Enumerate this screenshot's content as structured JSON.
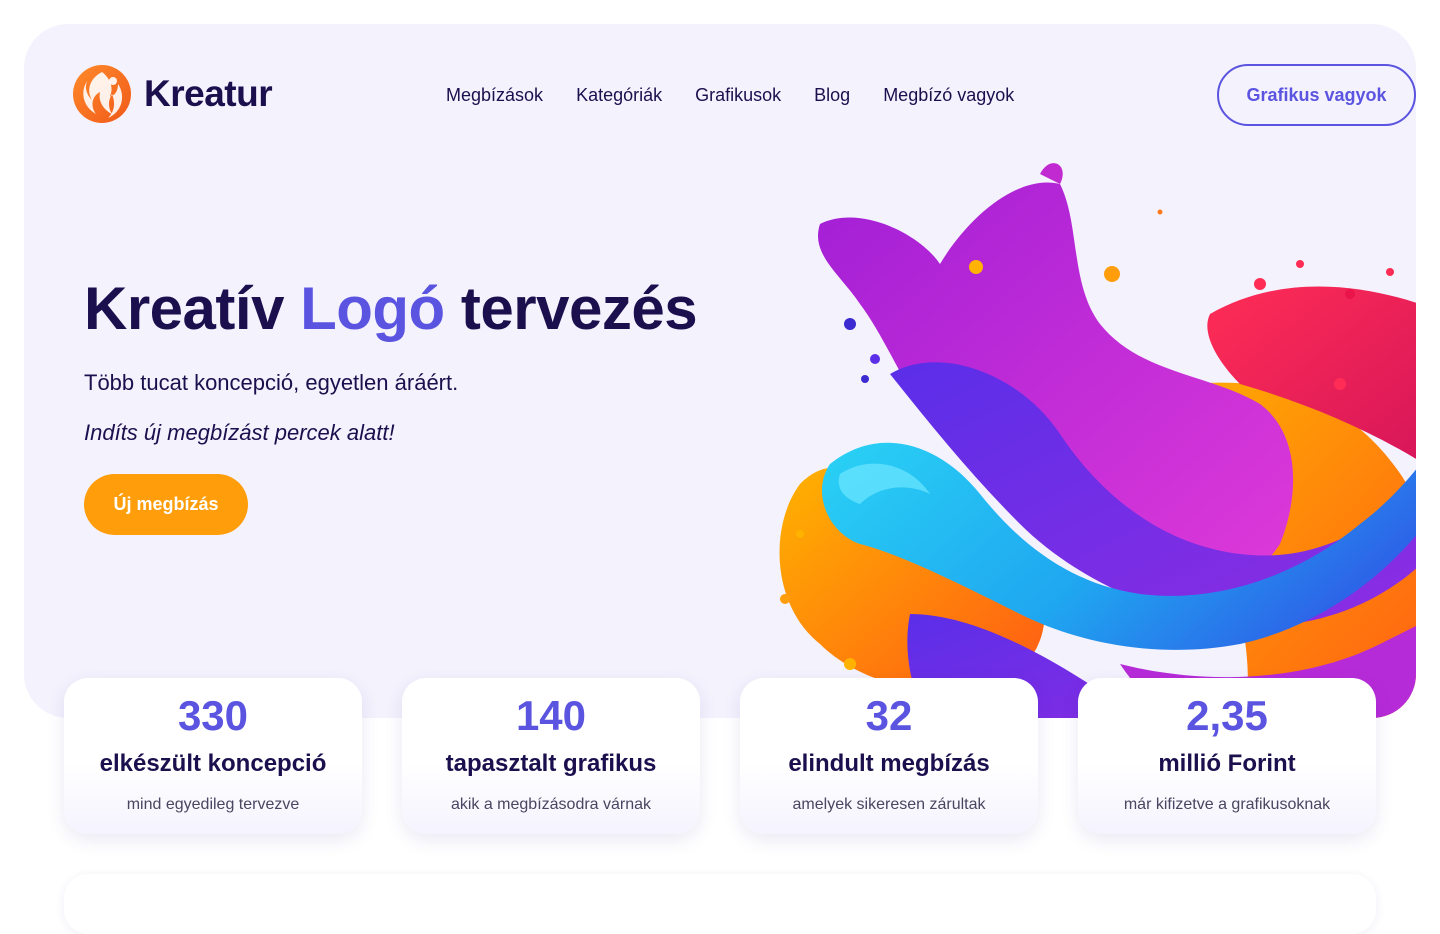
{
  "brand": {
    "name": "Kreatur",
    "logo_icon": "flame-swirl-icon",
    "color": "#f47a1f"
  },
  "nav": {
    "items": [
      {
        "label": "Megbízások"
      },
      {
        "label": "Kategóriák"
      },
      {
        "label": "Grafikusok"
      },
      {
        "label": "Blog"
      },
      {
        "label": "Megbízó vagyok"
      }
    ],
    "designer_button": "Grafikus vagyok"
  },
  "hero": {
    "title_part1": "Kreatív",
    "title_accent": "Logó",
    "title_part3": "tervezés",
    "subtitle": "Több tucat koncepció, egyetlen áráért.",
    "tagline": "Indíts új megbízást percek alatt!",
    "cta": "Új megbízás",
    "image": "colorful-paint-splash"
  },
  "stats": [
    {
      "value": "330",
      "title": "elkészült koncepció",
      "desc": "mind egyedileg tervezve"
    },
    {
      "value": "140",
      "title": "tapasztalt grafikus",
      "desc": "akik a megbízásodra várnak"
    },
    {
      "value": "32",
      "title": "elindult megbízás",
      "desc": "amelyek sikeresen zárultak"
    },
    {
      "value": "2,35",
      "title": "millió Forint",
      "desc": "már kifizetve a grafikusoknak"
    }
  ],
  "colors": {
    "primary": "#5b54e0",
    "dark": "#1c0f4e",
    "accent_orange": "#ff9e0a",
    "hero_bg": "#f4f2fd"
  }
}
